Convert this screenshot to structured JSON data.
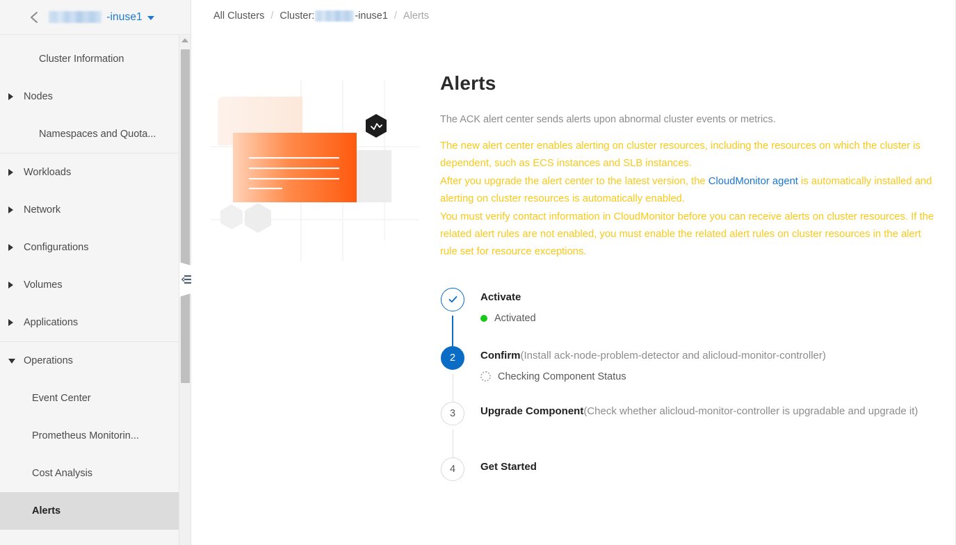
{
  "sidebar": {
    "cluster_header": {
      "back_icon": "back-chevron-icon",
      "cluster_name_redacted": true,
      "cluster_name_suffix": "-inuse1",
      "dropdown_icon": "chevron-down-icon"
    },
    "groups": [
      {
        "items": [
          {
            "label": "Cluster Information",
            "expandable": false,
            "active": false
          },
          {
            "label": "Nodes",
            "expandable": true,
            "expanded": false,
            "active": false
          },
          {
            "label": "Namespaces and Quota...",
            "expandable": false,
            "active": false
          }
        ]
      },
      {
        "items": [
          {
            "label": "Workloads",
            "expandable": true,
            "expanded": false,
            "active": false
          },
          {
            "label": "Network",
            "expandable": true,
            "expanded": false,
            "active": false
          },
          {
            "label": "Configurations",
            "expandable": true,
            "expanded": false,
            "active": false
          },
          {
            "label": "Volumes",
            "expandable": true,
            "expanded": false,
            "active": false
          },
          {
            "label": "Applications",
            "expandable": true,
            "expanded": false,
            "active": false
          }
        ]
      },
      {
        "items": [
          {
            "label": "Operations",
            "expandable": true,
            "expanded": true,
            "active": false
          },
          {
            "label": "Event Center",
            "child": true,
            "active": false
          },
          {
            "label": "Prometheus Monitorin...",
            "child": true,
            "active": false
          },
          {
            "label": "Cost Analysis",
            "child": true,
            "active": false
          },
          {
            "label": "Alerts",
            "child": true,
            "active": true
          }
        ]
      }
    ],
    "collapse_handle_icon": "collapse-menu-icon"
  },
  "breadcrumb": {
    "all_clusters": "All Clusters",
    "separator": "/",
    "cluster_prefix": "Cluster:",
    "cluster_suffix": "-inuse1",
    "current": "Alerts"
  },
  "main": {
    "title": "Alerts",
    "description": "The ACK alert center sends alerts upon abnormal cluster events or metrics.",
    "warning": {
      "line1": "The new alert center enables alerting on cluster resources, including the resources on which the cluster is dependent, such as ECS instances and SLB instances.",
      "line2_before_link": "After you upgrade the alert center to the latest version, the ",
      "link_text": "CloudMonitor agent",
      "line2_after_link": " is automatically installed and alerting on cluster resources is automatically enabled.",
      "line3": "You must verify contact information in CloudMonitor before you can receive alerts on cluster resources. If the related alert rules are not enabled, you must enable the related alert rules on cluster resources in the alert rule set for resource exceptions."
    },
    "steps": [
      {
        "index": "1",
        "state": "done",
        "marker_icon": "check-icon",
        "title": "Activate",
        "note": "",
        "substatus": "Activated",
        "substatus_icon": "green-dot-icon"
      },
      {
        "index": "2",
        "state": "current",
        "title": "Confirm",
        "note": "(Install ack-node-problem-detector and alicloud-monitor-controller)",
        "substatus": "Checking Component Status",
        "substatus_icon": "loading-spinner-icon"
      },
      {
        "index": "3",
        "state": "todo",
        "title": "Upgrade Component",
        "note": "(Check whether alicloud-monitor-controller is upgradable and upgrade it)",
        "substatus": "",
        "substatus_icon": ""
      },
      {
        "index": "4",
        "state": "todo",
        "title": "Get Started",
        "note": "",
        "substatus": "",
        "substatus_icon": ""
      }
    ]
  },
  "colors": {
    "accent_blue": "#0a6cc4",
    "link_blue": "#1a76d2",
    "warning_yellow": "#f9c918",
    "status_green": "#1ac81a",
    "sidebar_bg": "#f5f5f5",
    "active_item_bg": "#dcdcdc"
  }
}
